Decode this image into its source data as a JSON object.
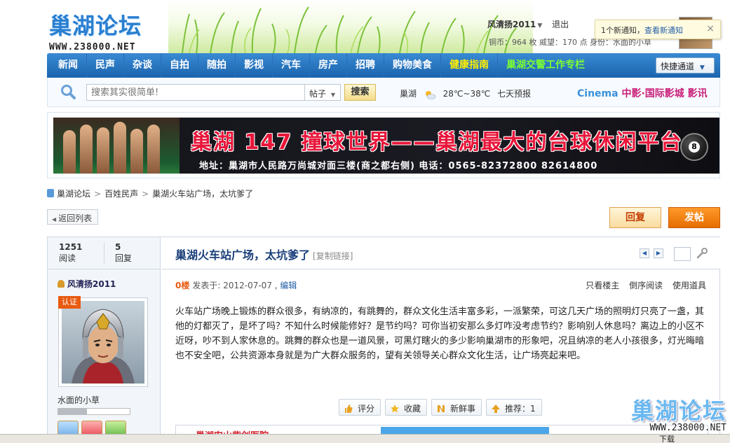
{
  "header": {
    "logo_text": "巢湖论坛",
    "logo_url": "WWW.238000.NET",
    "username": "风清扬2011",
    "logout": "退出",
    "stats": "铜币：964 枚   威望：170 点   身份：水面的小草"
  },
  "notice": {
    "text": "1个新通知，",
    "link": "查看新通知",
    "close": "×"
  },
  "nav": {
    "items": [
      {
        "label": "新闻",
        "color": "white"
      },
      {
        "label": "民声",
        "color": "white"
      },
      {
        "label": "杂谈",
        "color": "white"
      },
      {
        "label": "自拍",
        "color": "white"
      },
      {
        "label": "随拍",
        "color": "white"
      },
      {
        "label": "影视",
        "color": "white"
      },
      {
        "label": "汽车",
        "color": "white"
      },
      {
        "label": "房产",
        "color": "white"
      },
      {
        "label": "招聘",
        "color": "white"
      },
      {
        "label": "购物美食",
        "color": "white"
      },
      {
        "label": "健康指南",
        "color": "yellow"
      },
      {
        "label": "巢湖交警工作专栏",
        "color": "green"
      }
    ],
    "quick": "快捷通道"
  },
  "search": {
    "placeholder": "搜索其实很简单!",
    "type": "帖子",
    "button": "搜索"
  },
  "weather": {
    "city": "巢湖",
    "temp": "28℃~38℃",
    "forecast": "七天预报"
  },
  "cinema": {
    "logo": "Cinema",
    "text": "中影·国际影城 影讯"
  },
  "banner": {
    "title": "巢湖 147 撞球世界——巢湖最大的台球休闲平台",
    "address": "地址：巢湖市人民路万尚城对面三楼(商之都右侧)    电话：0565-82372800 82614800",
    "ball": "8"
  },
  "breadcrumb": {
    "items": [
      "巢湖论坛",
      "百姓民声",
      "巢湖火车站广场，太坑爹了"
    ]
  },
  "buttons": {
    "back": "返回列表",
    "reply": "回复",
    "post": "发帖"
  },
  "thread": {
    "views": "1251",
    "views_label": "阅读",
    "replies": "5",
    "replies_label": "回复",
    "title": "巢湖火车站广场，太坑爹了",
    "copy_link": "[复制链接]",
    "author": "风清扬2011",
    "verified": "认证",
    "author_group": "水面的小草",
    "rank_progress": 0.4,
    "floor": "0楼",
    "posted": "发表于: 2012-07-07 ,",
    "edit": "编辑",
    "tools": [
      "只看楼主",
      "倒序阅读",
      "使用道具"
    ],
    "body": "火车站广场晚上锻炼的群众很多，有纳凉的，有跳舞的，群众文化生活丰富多彩，一派繁荣，可这几天广场的照明灯只亮了一盏，其他的灯都灭了，是坏了吗？不知什么时候能修好？是节约吗？可你当初安那么多灯咋没考虑节约？影响别人休息吗？离边上的小区不近呀，吵不到人家休息的。跳舞的群众也是一道风景，可黑灯瞎火的多少影响巢湖市的形象吧，况且纳凉的老人小孩很多，灯光晦暗也不安全吧，公共资源本身就是为广大群众服务的，望有关领导关心群众文化生活，让广场亮起来吧。",
    "actions": [
      {
        "label": "评分",
        "icon": "thumb-up-icon"
      },
      {
        "label": "收藏",
        "icon": "star-icon"
      },
      {
        "label": "新鲜事",
        "icon": "news-icon"
      },
      {
        "label": "推荐：1",
        "icon": "arrow-up-icon"
      }
    ],
    "sub_banner": "巢湖安山紫剑医院"
  },
  "watermark": {
    "text": "巢湖论坛",
    "url": "WWW.238000.NET"
  },
  "statusbar": {
    "download": "下载"
  },
  "colors": {
    "nav_blue": "#1a64ad",
    "title_blue": "#1a3f7a",
    "post_orange": "#e56c00",
    "banner_red": "#e8163a"
  }
}
